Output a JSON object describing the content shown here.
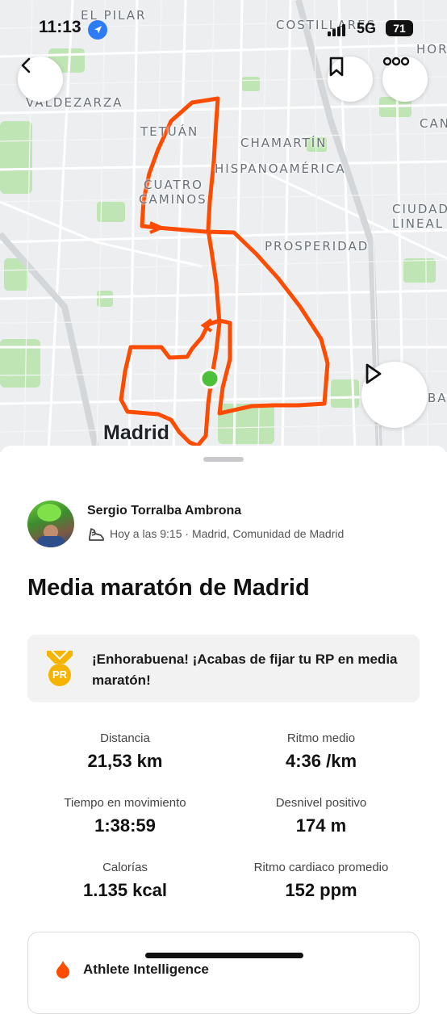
{
  "status_bar": {
    "time": "11:13",
    "network": "5G",
    "battery": "71"
  },
  "map": {
    "labels": [
      "EL PILAR",
      "COSTILLARES",
      "HORT",
      "VALDEZARZA",
      "CAN",
      "TETUÁN",
      "CHAMARTÍN",
      "HISPANOAMÉRICA",
      "CUATRO",
      "CAMINOS",
      "CIUDAD",
      "LINEAL",
      "PROSPERIDAD",
      "BAS"
    ],
    "city": "Madrid",
    "colors": {
      "route": "#fc4c02",
      "start": "#4cc038",
      "park": "#b9e4b0"
    }
  },
  "activity": {
    "athlete_name": "Sergio Torralba Ambrona",
    "meta": "Hoy a las 9:15 · Madrid, Comunidad de Madrid",
    "title": "Media maratón de Madrid",
    "pr_badge": "PR",
    "pr_message": "¡Enhorabuena! ¡Acabas de fijar tu RP en media maratón!",
    "stats": [
      {
        "label": "Distancia",
        "value": "21,53 km"
      },
      {
        "label": "Ritmo medio",
        "value": "4:36 /km"
      },
      {
        "label": "Tiempo en movimiento",
        "value": "1:38:59"
      },
      {
        "label": "Desnivel positivo",
        "value": "174 m"
      },
      {
        "label": "Calorías",
        "value": "1.135 kcal"
      },
      {
        "label": "Ritmo cardiaco promedio",
        "value": "152 ppm"
      }
    ],
    "card_title": "Athlete Intelligence"
  }
}
